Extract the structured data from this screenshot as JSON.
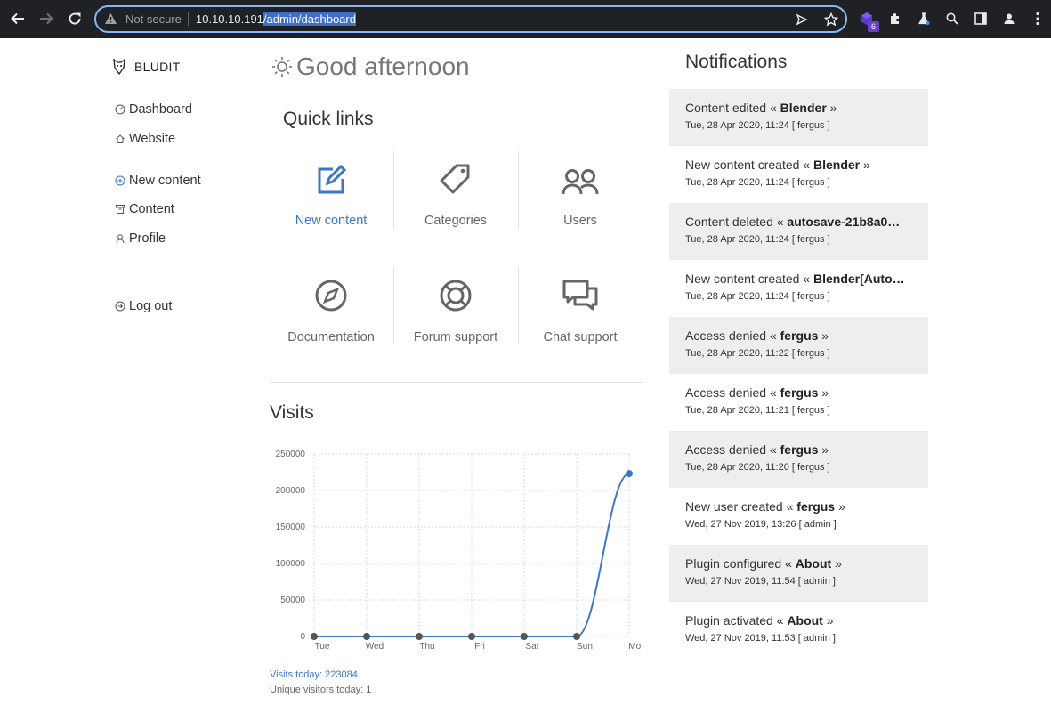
{
  "browser": {
    "security_label": "Not secure",
    "url_host": "10.10.10.191",
    "url_path": "/admin/dashboard",
    "extension_badge": "6"
  },
  "sidebar": {
    "brand": "BLUDIT",
    "items": [
      {
        "label": "Dashboard",
        "icon": "dashboard-icon"
      },
      {
        "label": "Website",
        "icon": "home-icon"
      },
      {
        "label": "New content",
        "icon": "plus-circle-icon"
      },
      {
        "label": "Content",
        "icon": "archive-icon"
      },
      {
        "label": "Profile",
        "icon": "user-icon"
      },
      {
        "label": "Log out",
        "icon": "logout-icon"
      }
    ]
  },
  "main": {
    "greeting": "Good afternoon",
    "quick_links_title": "Quick links",
    "quick_links": [
      {
        "label": "New content",
        "icon": "edit-icon"
      },
      {
        "label": "Categories",
        "icon": "tags-icon"
      },
      {
        "label": "Users",
        "icon": "users-icon"
      },
      {
        "label": "Documentation",
        "icon": "compass-icon"
      },
      {
        "label": "Forum support",
        "icon": "lifebuoy-icon"
      },
      {
        "label": "Chat support",
        "icon": "chat-icon"
      }
    ],
    "visits_title": "Visits",
    "visits_today": "Visits today: 223084",
    "unique_visitors": "Unique visitors today: 1"
  },
  "chart_data": {
    "type": "line",
    "categories": [
      "Tue",
      "Wed",
      "Thu",
      "Fri",
      "Sat",
      "Sun",
      "Mon"
    ],
    "series": [
      {
        "values": [
          0,
          0,
          0,
          0,
          0,
          0,
          223084
        ],
        "color": "#3d76c4"
      }
    ],
    "ylim": [
      0,
      250000
    ],
    "yticks": [
      0,
      50000,
      100000,
      150000,
      200000,
      250000
    ],
    "grid": true
  },
  "notifications": {
    "title": "Notifications",
    "items": [
      {
        "prefix": "Content edited « ",
        "subject": "Blender",
        "suffix": " »",
        "date": "Tue, 28 Apr 2020, 11:24 [ fergus ]"
      },
      {
        "prefix": "New content created « ",
        "subject": "Blender",
        "suffix": " »",
        "date": "Tue, 28 Apr 2020, 11:24 [ fergus ]"
      },
      {
        "prefix": "Content deleted « ",
        "subject": "autosave-21b8a0…",
        "suffix": "",
        "date": "Tue, 28 Apr 2020, 11:24 [ fergus ]"
      },
      {
        "prefix": "New content created « ",
        "subject": "Blender[Auto…",
        "suffix": "",
        "date": "Tue, 28 Apr 2020, 11:24 [ fergus ]"
      },
      {
        "prefix": "Access denied « ",
        "subject": "fergus",
        "suffix": " »",
        "date": "Tue, 28 Apr 2020, 11:22 [ fergus ]"
      },
      {
        "prefix": "Access denied « ",
        "subject": "fergus",
        "suffix": " »",
        "date": "Tue, 28 Apr 2020, 11:21 [ fergus ]"
      },
      {
        "prefix": "Access denied « ",
        "subject": "fergus",
        "suffix": " »",
        "date": "Tue, 28 Apr 2020, 11:20 [ fergus ]"
      },
      {
        "prefix": "New user created « ",
        "subject": "fergus",
        "suffix": " »",
        "date": "Wed, 27 Nov 2019, 13:26 [ admin ]"
      },
      {
        "prefix": "Plugin configured « ",
        "subject": "About",
        "suffix": " »",
        "date": "Wed, 27 Nov 2019, 11:54 [ admin ]"
      },
      {
        "prefix": "Plugin activated « ",
        "subject": "About",
        "suffix": " »",
        "date": "Wed, 27 Nov 2019, 11:53 [ admin ]"
      }
    ]
  }
}
